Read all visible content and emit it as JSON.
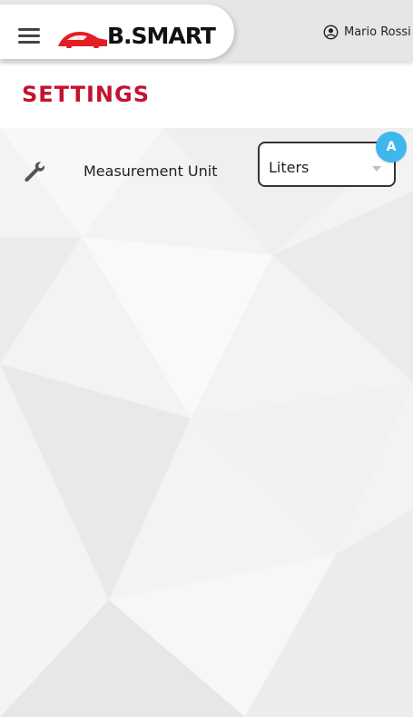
{
  "header": {
    "logo_text": "B.SMART",
    "user_name": "Mario Rossi",
    "menu_icon": "hamburger-menu-icon",
    "user_icon": "user-circle-icon"
  },
  "page": {
    "title": "SETTINGS"
  },
  "settings": [
    {
      "icon": "wrench-icon",
      "label": "Measurement Unit",
      "value": "Liters",
      "badge": "A"
    }
  ],
  "colors": {
    "title": "#c4122f",
    "logo_accent": "#e31e24",
    "badge": "#3fb6ee"
  }
}
